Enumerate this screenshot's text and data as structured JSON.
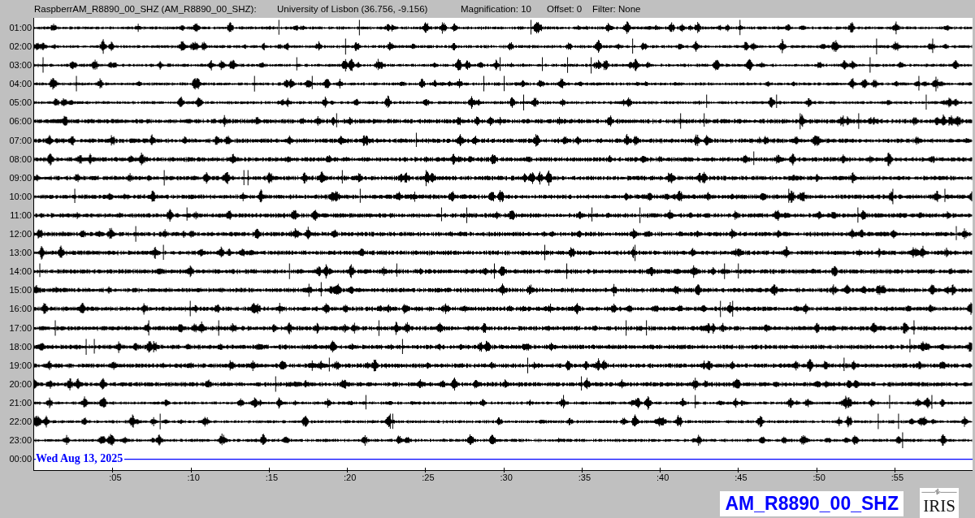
{
  "header": {
    "station": "RaspberrAM_R8890_00_SHZ (AM_R8890_00_SHZ):",
    "location": "University of Lisbon (36.756, -9.156)",
    "magnification": "Magnification: 10",
    "offset": "Offset: 0",
    "filter": "Filter: None"
  },
  "rows": [
    {
      "label": "01:00",
      "kind": "trace"
    },
    {
      "label": "02:00",
      "kind": "trace"
    },
    {
      "label": "03:00",
      "kind": "trace"
    },
    {
      "label": "04:00",
      "kind": "trace"
    },
    {
      "label": "05:00",
      "kind": "trace"
    },
    {
      "label": "06:00",
      "kind": "trace"
    },
    {
      "label": "07:00",
      "kind": "trace"
    },
    {
      "label": "08:00",
      "kind": "trace"
    },
    {
      "label": "09:00",
      "kind": "trace"
    },
    {
      "label": "10:00",
      "kind": "trace"
    },
    {
      "label": "11:00",
      "kind": "trace"
    },
    {
      "label": "12:00",
      "kind": "trace"
    },
    {
      "label": "13:00",
      "kind": "trace"
    },
    {
      "label": "14:00",
      "kind": "trace"
    },
    {
      "label": "15:00",
      "kind": "trace"
    },
    {
      "label": "16:00",
      "kind": "trace"
    },
    {
      "label": "17:00",
      "kind": "trace"
    },
    {
      "label": "18:00",
      "kind": "trace"
    },
    {
      "label": "19:00",
      "kind": "trace"
    },
    {
      "label": "20:00",
      "kind": "trace"
    },
    {
      "label": "21:00",
      "kind": "trace"
    },
    {
      "label": "22:00",
      "kind": "trace"
    },
    {
      "label": "23:00",
      "kind": "trace"
    },
    {
      "label": "00:00",
      "kind": "current"
    }
  ],
  "date_label": "Wed Aug 13, 2025",
  "x_ticks": [
    ":05",
    ":10",
    ":15",
    ":20",
    ":25",
    ":30",
    ":35",
    ":40",
    ":45",
    ":50",
    ":55"
  ],
  "station_badge": "AM_R8890_00_SHZ",
  "logo": "IRIS"
}
